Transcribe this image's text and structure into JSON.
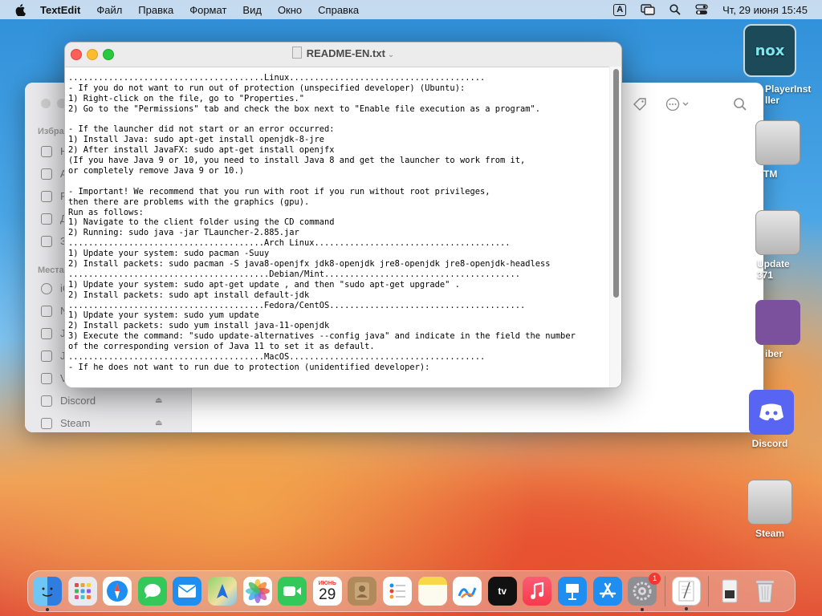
{
  "menubar": {
    "app_name": "TextEdit",
    "menus": [
      "Файл",
      "Правка",
      "Формат",
      "Вид",
      "Окно",
      "Справка"
    ],
    "input_source": "A",
    "clock": "Чт, 29 июня  15:45"
  },
  "finder": {
    "sidebar": {
      "favorites_header": "Избра",
      "favorites": [
        "Н",
        "А",
        "Р",
        "Д",
        "З"
      ],
      "places_header": "Места",
      "places": [
        "iC",
        "N",
        "J",
        "J",
        "V"
      ],
      "devices": [
        "Discord",
        "Steam"
      ]
    }
  },
  "textedit": {
    "title": "README-EN.txt",
    "scroll_position": 0.0,
    "lines": [
      ".......................................Linux.......................................",
      "- If you do not want to run out of protection (unspecified developer) (Ubuntu):",
      "1) Right-click on the file, go to \"Properties.\"",
      "2) Go to the \"Permissions\" tab and check the box next to \"Enable file execution as a program\".",
      "",
      "- If the launcher did not start or an error occurred:",
      "1) Install Java: sudo apt-get install openjdk-8-jre",
      "2) After install JavaFX: sudo apt-get install openjfx",
      "(If you have Java 9 or 10, you need to install Java 8 and get the launcher to work from it,",
      "or completely remove Java 9 or 10.)",
      "",
      "- Important! We recommend that you run with root if you run without root privileges,",
      "then there are problems with the graphics (gpu).",
      "Run as follows:",
      "1) Navigate to the client folder using the CD command",
      "2) Running: sudo java -jar TLauncher-2.885.jar",
      ".......................................Arch Linux.......................................",
      "1) Update your system: sudo pacman -Suuy",
      "2) Install packets: sudo pacman -S java8-openjfx jdk8-openjdk jre8-openjdk jre8-openjdk-headless",
      "........................................Debian/Mint.......................................",
      "1) Update your system: sudo apt-get update , and then \"sudo apt-get upgrade\" .",
      "2) Install packets: sudo apt install default-jdk",
      ".......................................Fedora/CentOS.......................................",
      "1) Update your system: sudo yum update",
      "2) Install packets: sudo yum install java-11-openjdk",
      "3) Execute the command: \"sudo update-alternatives --config java\" and indicate in the field the number",
      "of the corresponding version of Java 11 to set it as default.",
      ".......................................MacOS.......................................",
      "- If he does not want to run due to protection (unidentified developer):"
    ]
  },
  "desktop_icons": [
    {
      "label": "PlayerInst\nller"
    },
    {
      "label": "TM"
    },
    {
      "label": "Update 371"
    },
    {
      "label": "iber"
    },
    {
      "label": "Discord"
    },
    {
      "label": "Steam"
    }
  ],
  "dock": {
    "calendar_month": "ИЮНЬ",
    "calendar_day": "29",
    "settings_badge": "1",
    "apps": [
      "finder-icon",
      "launchpad-icon",
      "safari-icon",
      "messages-icon",
      "mail-icon",
      "maps-icon",
      "photos-icon",
      "facetime-icon",
      "calendar-icon",
      "contacts-icon",
      "reminders-icon",
      "notes-icon",
      "freeform-icon",
      "apple-tv-icon",
      "music-icon",
      "keynote-icon",
      "app-store-icon",
      "system-settings-icon",
      "textedit-icon",
      "downloads-icon",
      "trash-icon"
    ]
  },
  "colors": {
    "close": "#fe5f57",
    "minimize": "#febc2e",
    "maximize": "#28c840"
  }
}
